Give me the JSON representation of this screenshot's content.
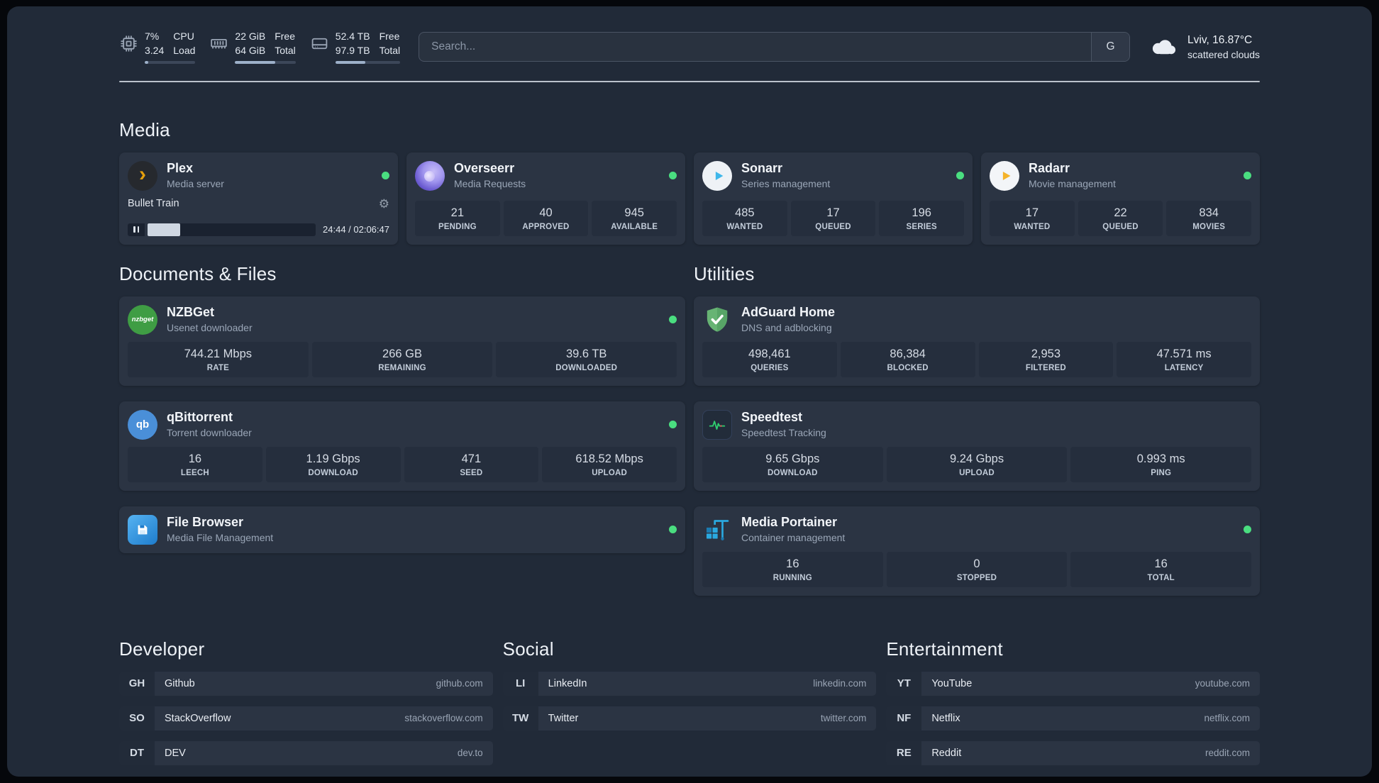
{
  "topbar": {
    "cpu": {
      "value_top": "7%",
      "value_bottom": "3.24",
      "label_top": "CPU",
      "label_bottom": "Load",
      "bar_width": "7%"
    },
    "memory": {
      "value_top": "22 GiB",
      "value_bottom": "64 GiB",
      "label_top": "Free",
      "label_bottom": "Total",
      "bar_width": "66%"
    },
    "disk": {
      "value_top": "52.4 TB",
      "value_bottom": "97.9 TB",
      "label_top": "Free",
      "label_bottom": "Total",
      "bar_width": "46%"
    },
    "search": {
      "placeholder": "Search...",
      "provider": "G"
    },
    "weather": {
      "location": "Lviv, 16.87°C",
      "condition": "scattered clouds"
    }
  },
  "icons": {
    "gear": "⚙",
    "plex_chevron": "›"
  },
  "colors": {
    "status_online": "#4ade80",
    "progress_fill": "#9db0c9",
    "plex_amber": "#e5a00d",
    "sonarr_blue": "#3eb7ea",
    "radarr_amber": "#f5b32a",
    "nzbget_green": "#3f9d44",
    "qbittorrent_blue": "#4a8fd8",
    "filebrowser_blue": "#1e7ccc",
    "adguard_green": "#67b474",
    "speedtest_green": "#2fcf6f",
    "portainer_blue": "#2aa9e0",
    "overseerr_purple": "#8a7ae0"
  },
  "media": {
    "title": "Media",
    "plex": {
      "name": "Plex",
      "subtitle": "Media server",
      "now_playing": "Bullet Train",
      "elapsed_total": "24:44 / 02:06:47",
      "progress": "19.5%"
    },
    "overseerr": {
      "name": "Overseerr",
      "subtitle": "Media Requests",
      "stats": [
        {
          "value": "21",
          "label": "PENDING"
        },
        {
          "value": "40",
          "label": "APPROVED"
        },
        {
          "value": "945",
          "label": "AVAILABLE"
        }
      ]
    },
    "sonarr": {
      "name": "Sonarr",
      "subtitle": "Series management",
      "stats": [
        {
          "value": "485",
          "label": "WANTED"
        },
        {
          "value": "17",
          "label": "QUEUED"
        },
        {
          "value": "196",
          "label": "SERIES"
        }
      ]
    },
    "radarr": {
      "name": "Radarr",
      "subtitle": "Movie management",
      "stats": [
        {
          "value": "17",
          "label": "WANTED"
        },
        {
          "value": "22",
          "label": "QUEUED"
        },
        {
          "value": "834",
          "label": "MOVIES"
        }
      ]
    }
  },
  "documents": {
    "title": "Documents & Files",
    "nzbget": {
      "name": "NZBGet",
      "subtitle": "Usenet downloader",
      "icon_text": "nzbget",
      "stats": [
        {
          "value": "744.21 Mbps",
          "label": "RATE"
        },
        {
          "value": "266 GB",
          "label": "REMAINING"
        },
        {
          "value": "39.6 TB",
          "label": "DOWNLOADED"
        }
      ]
    },
    "qbittorrent": {
      "name": "qBittorrent",
      "subtitle": "Torrent downloader",
      "icon_text": "qb",
      "stats": [
        {
          "value": "16",
          "label": "LEECH"
        },
        {
          "value": "1.19 Gbps",
          "label": "DOWNLOAD"
        },
        {
          "value": "471",
          "label": "SEED"
        },
        {
          "value": "618.52 Mbps",
          "label": "UPLOAD"
        }
      ]
    },
    "filebrowser": {
      "name": "File Browser",
      "subtitle": "Media File Management"
    }
  },
  "utilities": {
    "title": "Utilities",
    "adguard": {
      "name": "AdGuard Home",
      "subtitle": "DNS and adblocking",
      "stats": [
        {
          "value": "498,461",
          "label": "QUERIES"
        },
        {
          "value": "86,384",
          "label": "BLOCKED"
        },
        {
          "value": "2,953",
          "label": "FILTERED"
        },
        {
          "value": "47.571 ms",
          "label": "LATENCY"
        }
      ]
    },
    "speedtest": {
      "name": "Speedtest",
      "subtitle": "Speedtest Tracking",
      "stats": [
        {
          "value": "9.65 Gbps",
          "label": "DOWNLOAD"
        },
        {
          "value": "9.24 Gbps",
          "label": "UPLOAD"
        },
        {
          "value": "0.993 ms",
          "label": "PING"
        }
      ]
    },
    "portainer": {
      "name": "Media Portainer",
      "subtitle": "Container management",
      "stats": [
        {
          "value": "16",
          "label": "RUNNING"
        },
        {
          "value": "0",
          "label": "STOPPED"
        },
        {
          "value": "16",
          "label": "TOTAL"
        }
      ]
    }
  },
  "bookmarks": {
    "developer": {
      "title": "Developer",
      "items": [
        {
          "abbr": "GH",
          "name": "Github",
          "domain": "github.com"
        },
        {
          "abbr": "SO",
          "name": "StackOverflow",
          "domain": "stackoverflow.com"
        },
        {
          "abbr": "DT",
          "name": "DEV",
          "domain": "dev.to"
        }
      ]
    },
    "social": {
      "title": "Social",
      "items": [
        {
          "abbr": "LI",
          "name": "LinkedIn",
          "domain": "linkedin.com"
        },
        {
          "abbr": "TW",
          "name": "Twitter",
          "domain": "twitter.com"
        }
      ]
    },
    "entertainment": {
      "title": "Entertainment",
      "items": [
        {
          "abbr": "YT",
          "name": "YouTube",
          "domain": "youtube.com"
        },
        {
          "abbr": "NF",
          "name": "Netflix",
          "domain": "netflix.com"
        },
        {
          "abbr": "RE",
          "name": "Reddit",
          "domain": "reddit.com"
        }
      ]
    }
  }
}
